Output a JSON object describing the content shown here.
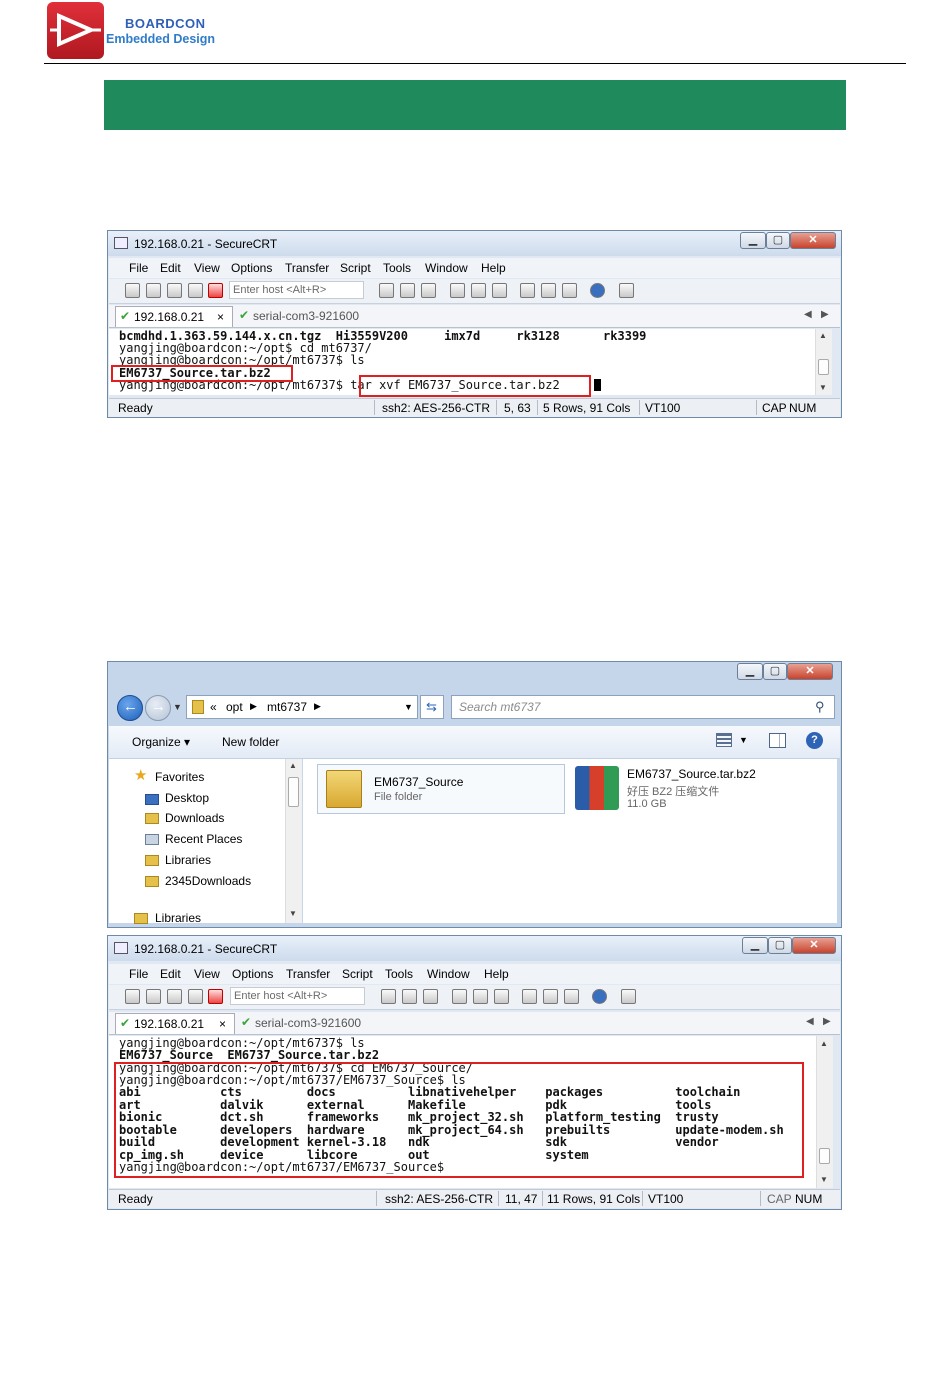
{
  "header": {
    "brand_name": "BOARDCON",
    "brand_tagline": "Embedded Design"
  },
  "crt_window_1": {
    "title": "192.168.0.21 - SecureCRT",
    "menu": [
      "File",
      "Edit",
      "View",
      "Options",
      "Transfer",
      "Script",
      "Tools",
      "Window",
      "Help"
    ],
    "host_placeholder": "Enter host <Alt+R>",
    "tabs": [
      {
        "label": "192.168.0.21",
        "close": "×"
      },
      {
        "label": "serial-com3-921600"
      }
    ],
    "terminal_lines": [
      "bcmdhd.1.363.59.144.x.cn.tgz  Hi3559V200     imx7d     rk3128      rk3399",
      "yangjing@boardcon:~/opt$ cd mt6737/",
      "yangjing@boardcon:~/opt/mt6737$ ls",
      "EM6737_Source.tar.bz2",
      "yangjing@boardcon:~/opt/mt6737$ tar xvf EM6737_Source.tar.bz2"
    ],
    "status": {
      "ready": "Ready",
      "cipher": "ssh2: AES-256-CTR",
      "cursor": "5, 63",
      "size": "5 Rows, 91 Cols",
      "emulation": "VT100",
      "cap": "CAP",
      "num": "NUM"
    }
  },
  "explorer_window": {
    "breadcrumb": [
      "«",
      "opt",
      "mt6737"
    ],
    "search_placeholder": "Search mt6737",
    "organize_label": "Organize ▾",
    "new_folder_label": "New folder",
    "nav_items": [
      "Favorites",
      "Desktop",
      "Downloads",
      "Recent Places",
      "Libraries",
      "2345Downloads",
      "Libraries"
    ],
    "files": [
      {
        "name": "EM6737_Source",
        "type": "File folder"
      },
      {
        "name": "EM6737_Source.tar.bz2",
        "type": "好压 BZ2 压缩文件",
        "size": "11.0 GB"
      }
    ]
  },
  "crt_window_2": {
    "title": "192.168.0.21 - SecureCRT",
    "menu": [
      "File",
      "Edit",
      "View",
      "Options",
      "Transfer",
      "Script",
      "Tools",
      "Window",
      "Help"
    ],
    "host_placeholder": "Enter host <Alt+R>",
    "tabs": [
      {
        "label": "192.168.0.21",
        "close": "×"
      },
      {
        "label": "serial-com3-921600"
      }
    ],
    "terminal_lines": [
      "yangjing@boardcon:~/opt/mt6737$ ls",
      "EM6737_Source  EM6737_Source.tar.bz2",
      "yangjing@boardcon:~/opt/mt6737$ cd EM6737_Source/",
      "yangjing@boardcon:~/opt/mt6737/EM6737_Source$ ls",
      "abi           cts         docs          libnativehelper    packages          toolchain",
      "art           dalvik      external      Makefile           pdk               tools",
      "bionic        dct.sh      frameworks    mk_project_32.sh   platform_testing  trusty",
      "bootable      developers  hardware      mk_project_64.sh   prebuilts         update-modem.sh",
      "build         development kernel-3.18   ndk                sdk               vendor",
      "cp_img.sh     device      libcore       out                system",
      "yangjing@boardcon:~/opt/mt6737/EM6737_Source$"
    ],
    "status": {
      "ready": "Ready",
      "cipher": "ssh2: AES-256-CTR",
      "cursor": "11, 47",
      "size": "11 Rows, 91 Cols",
      "emulation": "VT100",
      "cap": "CAP",
      "num": "NUM"
    }
  }
}
